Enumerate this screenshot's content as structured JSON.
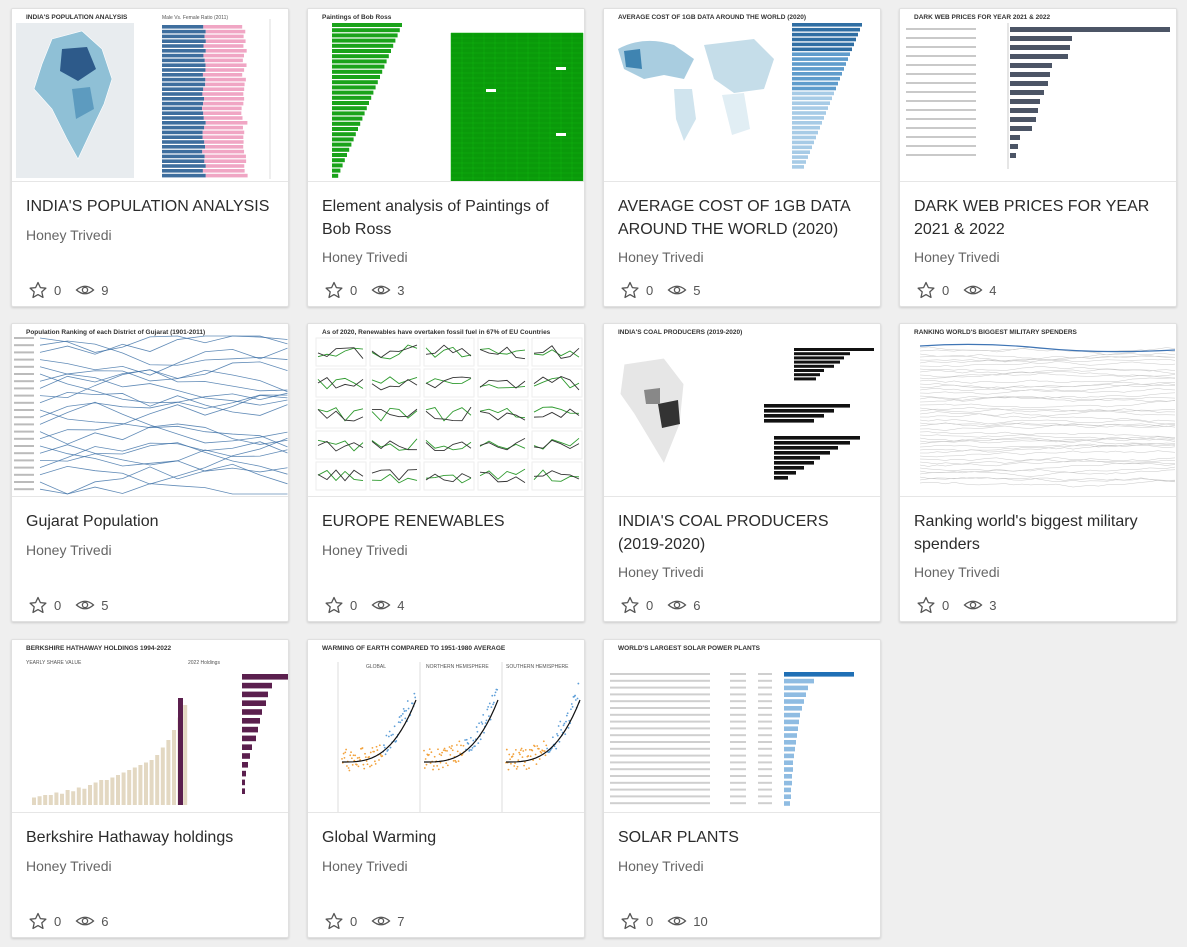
{
  "cards": [
    {
      "title": "INDIA'S POPULATION ANALYSIS",
      "author": "Honey Trivedi",
      "favorites": "0",
      "views": "9",
      "thumb_caption": "INDIA'S POPULATION ANALYSIS",
      "thumb_sub": "Male Vs. Female Ratio (2011)"
    },
    {
      "title": "Element analysis of Paintings of Bob Ross",
      "author": "Honey Trivedi",
      "favorites": "0",
      "views": "3",
      "thumb_caption": "Paintings of Bob Ross"
    },
    {
      "title": "AVERAGE COST OF 1GB DATA AROUND THE WORLD (2020)",
      "author": "Honey Trivedi",
      "favorites": "0",
      "views": "5",
      "thumb_caption": "AVERAGE COST OF 1GB DATA AROUND THE WORLD (2020)"
    },
    {
      "title": "DARK WEB PRICES FOR YEAR 2021 & 2022",
      "author": "Honey Trivedi",
      "favorites": "0",
      "views": "4",
      "thumb_caption": "DARK WEB PRICES FOR YEAR 2021 & 2022"
    },
    {
      "title": "Gujarat Population",
      "author": "Honey Trivedi",
      "favorites": "0",
      "views": "5",
      "thumb_caption": "Population Ranking of each District of Gujarat (1901-2011)"
    },
    {
      "title": "EUROPE RENEWABLES",
      "author": "Honey Trivedi",
      "favorites": "0",
      "views": "4",
      "thumb_caption": "As of 2020, Renewables have overtaken fossil fuel in 67% of EU Countries"
    },
    {
      "title": "INDIA'S COAL PRODUCERS (2019-2020)",
      "author": "Honey Trivedi",
      "favorites": "0",
      "views": "6",
      "thumb_caption": "INDIA'S COAL PRODUCERS (2019-2020)"
    },
    {
      "title": "Ranking world's biggest military spenders",
      "author": "Honey Trivedi",
      "favorites": "0",
      "views": "3",
      "thumb_caption": "RANKING WORLD'S BIGGEST MILITARY SPENDERS"
    },
    {
      "title": "Berkshire Hathaway holdings",
      "author": "Honey Trivedi",
      "favorites": "0",
      "views": "6",
      "thumb_caption": "BERKSHIRE HATHAWAY HOLDINGS 1994-2022",
      "thumb_sub": "YEARLY SHARE VALUE",
      "thumb_sub2": "2022 Holdings"
    },
    {
      "title": "Global Warming",
      "author": "Honey Trivedi",
      "favorites": "0",
      "views": "7",
      "thumb_caption": "WARMING OF EARTH COMPARED TO 1951-1980 AVERAGE",
      "thumb_sub": "GLOBAL",
      "thumb_sub2": "NORTHERN HEMISPHERE",
      "thumb_sub3": "SOUTHERN HEMISPHERE"
    },
    {
      "title": "SOLAR PLANTS",
      "author": "Honey Trivedi",
      "favorites": "0",
      "views": "10",
      "thumb_caption": "WORLD'S LARGEST SOLAR POWER PLANTS"
    }
  ],
  "colors": {
    "star": "#555555",
    "eye": "#555555",
    "title": "#2b2b2b",
    "author": "#666666"
  },
  "icons": {
    "favorite": "star-outline-icon",
    "views": "eye-icon"
  }
}
